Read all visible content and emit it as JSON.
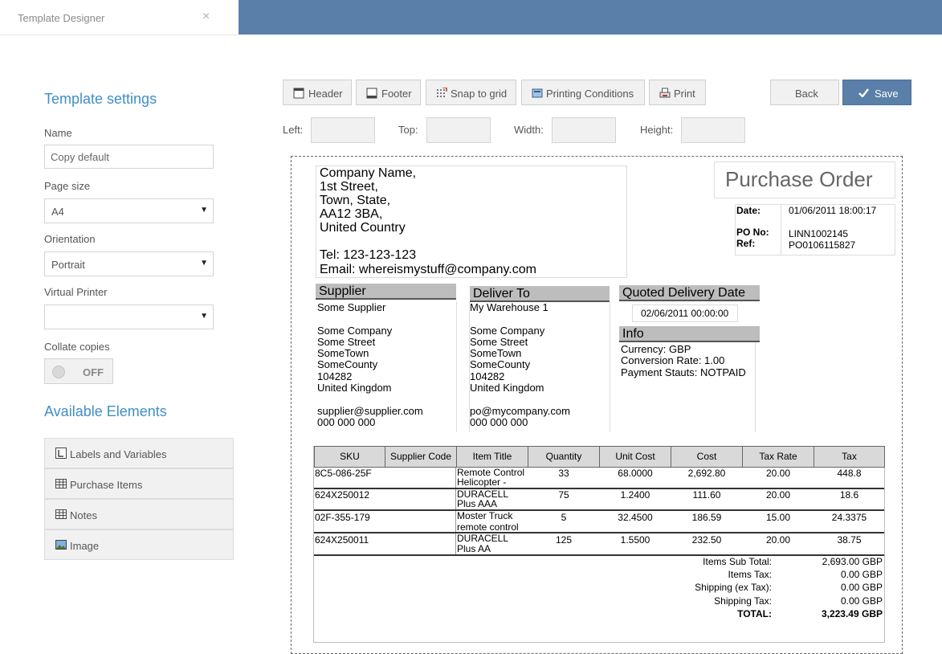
{
  "window": {
    "title": "Template Designer"
  },
  "sidebar": {
    "settings_title": "Template settings",
    "name_label": "Name",
    "name_value": "Copy default",
    "page_size_label": "Page size",
    "page_size_value": "A4",
    "orientation_label": "Orientation",
    "orientation_value": "Portrait",
    "virtual_printer_label": "Virtual Printer",
    "virtual_printer_value": "",
    "collate_label": "Collate copies",
    "collate_value": "OFF",
    "elements_title": "Available Elements",
    "elements": [
      {
        "label": "Labels and Variables",
        "icon": "label-variable-icon"
      },
      {
        "label": "Purchase Items",
        "icon": "table-icon"
      },
      {
        "label": "Notes",
        "icon": "table-icon"
      },
      {
        "label": "Image",
        "icon": "image-icon"
      }
    ]
  },
  "toolbar": {
    "header": "Header",
    "footer": "Footer",
    "snap": "Snap to grid",
    "printing_conditions": "Printing Conditions",
    "print": "Print",
    "back": "Back",
    "save": "Save",
    "left_label": "Left:",
    "top_label": "Top:",
    "width_label": "Width:",
    "height_label": "Height:"
  },
  "document": {
    "company": [
      "Company Name,",
      "1st Street,",
      "Town, State,",
      "AA12 3BA,",
      "United Country",
      "",
      "Tel: 123-123-123",
      "Email: whereismystuff@company.com"
    ],
    "title": "Purchase Order",
    "date_label": "Date:",
    "date_value": "01/06/2011 18:00:17",
    "po_label": "PO No:",
    "po_value": "LINN1002145",
    "ref_label": "Ref:",
    "ref_value": "PO0106115827",
    "supplier_header": "Supplier",
    "supplier_lines": "Some Supplier\n\nSome Company\nSome Street\nSomeTown\nSomeCounty\n104282\nUnited Kingdom\n\nsupplier@supplier.com\n000 000 000",
    "deliver_header": "Deliver To",
    "deliver_lines": "My Warehouse 1\n\nSome Company\nSome Street\nSomeTown\nSomeCounty\n104282\nUnited Kingdom\n\npo@mycompany.com\n000 000 000",
    "quoted_header": "Quoted Delivery Date",
    "quoted_value": "02/06/2011 00:00:00",
    "info_header": "Info",
    "info_lines": "Currency: GBP\nConversion Rate: 1.00\nPayment Stauts: NOTPAID",
    "columns": [
      "SKU",
      "Supplier Code",
      "Item Title",
      "Quantity",
      "Unit Cost",
      "Cost",
      "Tax Rate",
      "Tax"
    ],
    "rows": [
      {
        "sku": "8C5-086-25F",
        "supplier_code": "",
        "title1": "Remote Control",
        "title2": "Helicopter -",
        "qty": "33",
        "unit": "68.0000",
        "cost": "2,692.80",
        "rate": "20.00",
        "tax": "448.8"
      },
      {
        "sku": "624X250012",
        "supplier_code": "",
        "title1": "DURACELL",
        "title2": "Plus AAA",
        "qty": "75",
        "unit": "1.2400",
        "cost": "111.60",
        "rate": "20.00",
        "tax": "18.6"
      },
      {
        "sku": "02F-355-179",
        "supplier_code": "",
        "title1": "Moster Truck",
        "title2": "remote control",
        "qty": "5",
        "unit": "32.4500",
        "cost": "186.59",
        "rate": "15.00",
        "tax": "24.3375"
      },
      {
        "sku": "624X250011",
        "supplier_code": "",
        "title1": "DURACELL",
        "title2": "Plus AA",
        "qty": "125",
        "unit": "1.5500",
        "cost": "232.50",
        "rate": "20.00",
        "tax": "38.75"
      }
    ],
    "totals": [
      {
        "label": "Items Sub Total:",
        "value": "2,693.00 GBP"
      },
      {
        "label": "Items Tax:",
        "value": "0.00 GBP"
      },
      {
        "label": "Shipping (ex Tax):",
        "value": "0.00 GBP"
      },
      {
        "label": "Shipping Tax:",
        "value": "0.00 GBP"
      },
      {
        "label": "TOTAL:",
        "value": "3,223.49 GBP"
      }
    ]
  }
}
